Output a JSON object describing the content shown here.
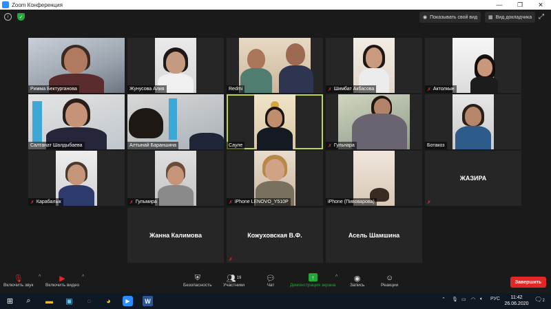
{
  "window": {
    "title": "Zoom Конференция",
    "controls": [
      "—",
      "❐",
      "✕"
    ]
  },
  "topbar": {
    "view_mode_label": "Показывать свой вид",
    "gallery_label": "Вид докладчика"
  },
  "participants": [
    {
      "name": "Римма Бектурганова",
      "muted": false
    },
    {
      "name": "Жунусова Алия",
      "muted": false
    },
    {
      "name": "Redmi",
      "muted": false
    },
    {
      "name": "Шимбат Акбасова",
      "muted": true
    },
    {
      "name": "Актолкын",
      "muted": true
    },
    {
      "name": "Салтанат Шалдыбаева",
      "muted": false
    },
    {
      "name": "Алтынай Бараншина",
      "muted": false
    },
    {
      "name": "Сауле",
      "muted": false
    },
    {
      "name": "Гульнара",
      "muted": true
    },
    {
      "name": "Ботакоз",
      "muted": false
    },
    {
      "name": "Карабалык",
      "muted": true
    },
    {
      "name": "Гульмира",
      "muted": true
    },
    {
      "name": "iPhone LENOVO_Y510P",
      "muted": true
    },
    {
      "name": "iPhone (Пивоварова)",
      "muted": false
    },
    {
      "name": "ЖАЗИРА",
      "muted": true
    },
    {
      "name": "Жанна Калимова",
      "muted": false
    },
    {
      "name": "Кожуховская В.Ф.",
      "muted": true
    },
    {
      "name": "Асель Шамшина",
      "muted": false
    }
  ],
  "toolbar": {
    "mute": "Включить звук",
    "video": "Включить видео",
    "security": "Безопасность",
    "participants": "Участники",
    "participants_count": "19",
    "chat": "Чат",
    "share": "Демонстрация экрана",
    "record": "Запись",
    "reactions": "Реакции",
    "end": "Завершить"
  },
  "taskbar": {
    "lang": "РУС",
    "time": "11:42",
    "date": "26.06.2020",
    "notifications": "2"
  },
  "colors": {
    "active_speaker": "#b8d64e",
    "end_button": "#e02828",
    "share_green": "#23a839"
  }
}
